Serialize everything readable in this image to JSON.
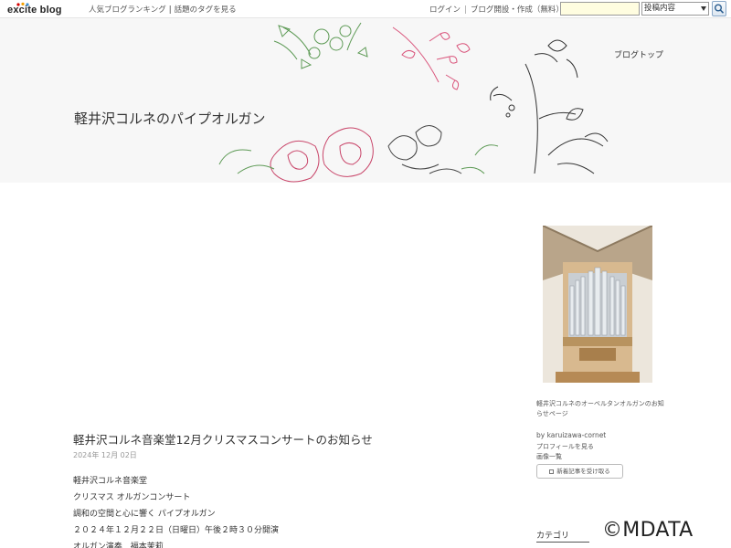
{
  "topbar": {
    "logo": "excite blog",
    "nav_left": [
      "人気ブログランキング",
      "話題のタグを見る"
    ],
    "nav_right": [
      "ログイン",
      "ブログ開設・作成（無料）"
    ],
    "search": {
      "value": "",
      "placeholder": ""
    },
    "search_select": "投稿内容",
    "search_icon": "search-icon"
  },
  "header": {
    "blog_title": "軽井沢コルネのパイプオルガン",
    "blog_top_link": "ブログトップ"
  },
  "post": {
    "title": "軽井沢コルネ音楽堂12月クリスマスコンサートのお知らせ",
    "date": "2024年 12月 02日",
    "lines": [
      "軽井沢コルネ音楽堂",
      "クリスマス オルガンコンサート",
      "調和の空間と心に響く パイプオルガン",
      "２０２４年１２月２２日（日曜日）午後２時３０分開演",
      "オルガン演奏　福本茉莉"
    ]
  },
  "sidebar": {
    "description": "軽井沢コルネのオーベルタンオルガンのお知らせページ",
    "by_label": "by karuizawa-cornet",
    "profile_link": "プロフィールを見る",
    "gallery_link": "画像一覧",
    "subscribe_label": "新着記事を受け取る",
    "category_heading": "カテゴリ"
  },
  "watermark": "©MDATA",
  "colors": {
    "accent_red": "#d40000",
    "header_bg": "#f7f7f7",
    "flower_pink": "#d9537a",
    "leaf_green": "#6aa85c",
    "organ_wood": "#d8b98f"
  }
}
